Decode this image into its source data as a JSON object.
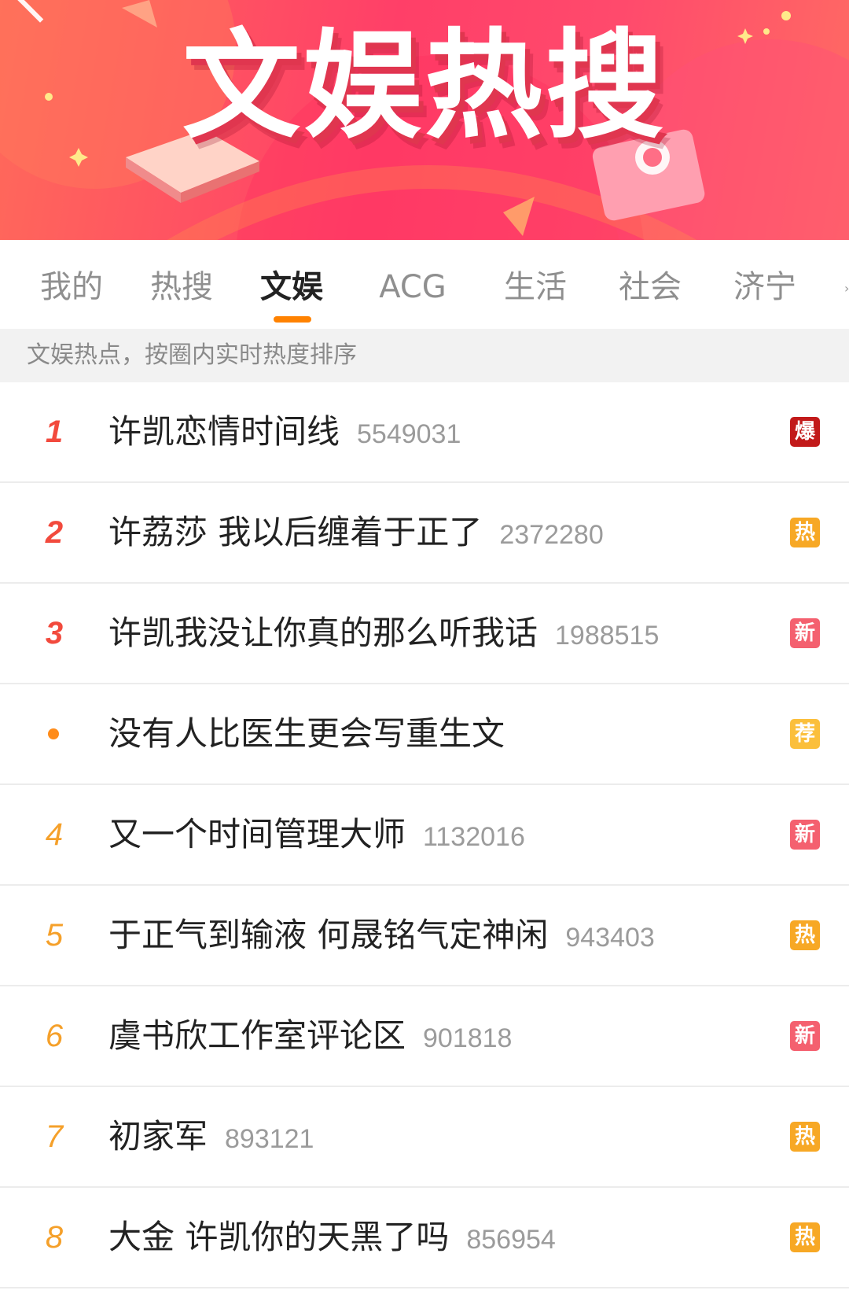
{
  "banner": {
    "title": "文娱热搜",
    "colors": {
      "primary": "#ff4a6c",
      "shadow": "#e0364f"
    }
  },
  "tabs": [
    {
      "label": "我的",
      "active": false
    },
    {
      "label": "热搜",
      "active": false
    },
    {
      "label": "文娱",
      "active": true
    },
    {
      "label": "ACG",
      "active": false
    },
    {
      "label": "生活",
      "active": false
    },
    {
      "label": "社会",
      "active": false
    },
    {
      "label": "济宁",
      "active": false
    }
  ],
  "subtitle": "文娱热点，按圈内实时热度排序",
  "accent_color": "#ff8200",
  "badge_colors": {
    "爆": "#c21a1a",
    "热": "#f7a825",
    "新": "#f4606f",
    "荐": "#fbbf3b"
  },
  "items": [
    {
      "rank": "1",
      "title": "许凯恋情时间线",
      "count": "5549031",
      "badge": "爆"
    },
    {
      "rank": "2",
      "title": "许荔莎 我以后缠着于正了",
      "count": "2372280",
      "badge": "热"
    },
    {
      "rank": "3",
      "title": "许凯我没让你真的那么听我话",
      "count": "1988515",
      "badge": "新"
    },
    {
      "rank": "",
      "title": "没有人比医生更会写重生文",
      "count": "",
      "badge": "荐"
    },
    {
      "rank": "4",
      "title": "又一个时间管理大师",
      "count": "1132016",
      "badge": "新"
    },
    {
      "rank": "5",
      "title": "于正气到输液 何晟铭气定神闲",
      "count": "943403",
      "badge": "热"
    },
    {
      "rank": "6",
      "title": "虞书欣工作室评论区",
      "count": "901818",
      "badge": "新"
    },
    {
      "rank": "7",
      "title": "初家军",
      "count": "893121",
      "badge": "热"
    },
    {
      "rank": "8",
      "title": "大金 许凯你的天黑了吗",
      "count": "856954",
      "badge": "热"
    }
  ]
}
